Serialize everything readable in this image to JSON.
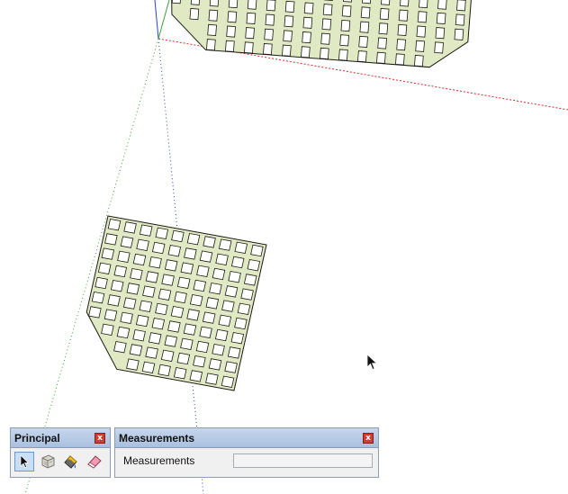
{
  "toolbars": {
    "principal": {
      "title": "Principal",
      "close_label": "x",
      "tools": [
        {
          "name": "select-tool",
          "icon": "arrow-cursor-icon",
          "active": true
        },
        {
          "name": "make-component-tool",
          "icon": "component-box-icon",
          "active": false
        },
        {
          "name": "paint-bucket-tool",
          "icon": "paint-bucket-icon",
          "active": false
        },
        {
          "name": "eraser-tool",
          "icon": "eraser-icon",
          "active": false
        }
      ]
    },
    "measurements": {
      "title": "Measurements",
      "close_label": "x",
      "label": "Measurements",
      "value": ""
    }
  },
  "scene": {
    "colors": {
      "background": "#ffffff",
      "grid_face": "#e1e8c4",
      "grid_edge": "#1a1a12",
      "red_axis": "#d42c2c",
      "green_axis": "#3aa23a",
      "blue_axis": "#2a40c8"
    }
  }
}
